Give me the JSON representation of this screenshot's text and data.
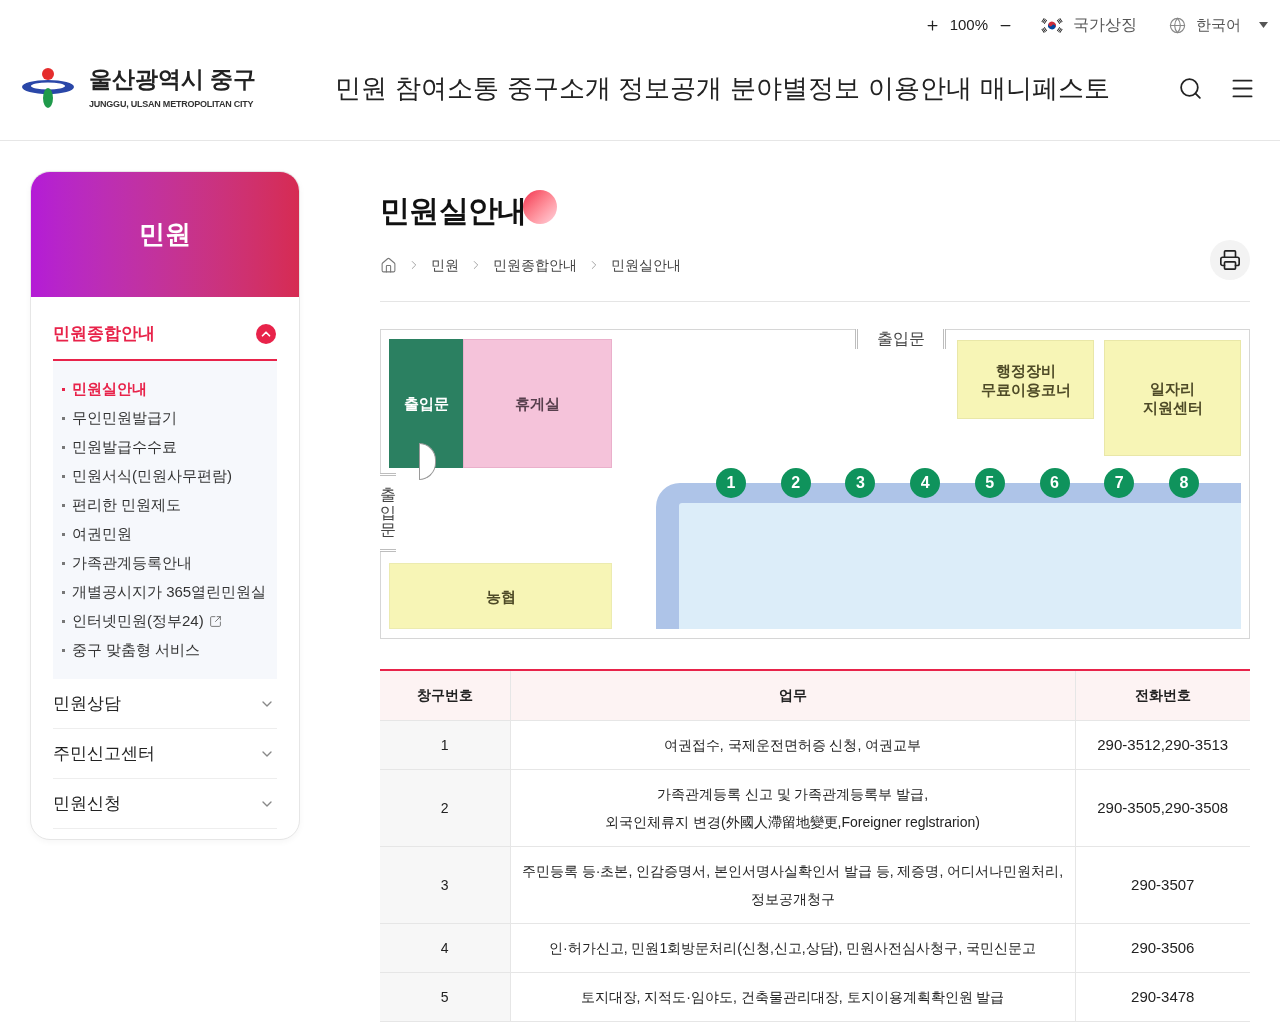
{
  "utility_bar": {
    "zoom_level": "100%",
    "national_symbols": "국가상징",
    "language": "한국어"
  },
  "header": {
    "logo": {
      "title": "울산광역시 중구",
      "subtitle": "JUNGGU, ULSAN METROPOLITAN CITY"
    },
    "nav": [
      "민원",
      "참여소통",
      "중구소개",
      "정보공개",
      "분야별정보",
      "이용안내",
      "매니페스토"
    ]
  },
  "sidebar": {
    "title": "민원",
    "sections": [
      {
        "label": "민원종합안내",
        "expanded": true,
        "children": [
          {
            "label": "민원실안내",
            "selected": true,
            "external": false
          },
          {
            "label": "무인민원발급기",
            "selected": false,
            "external": false
          },
          {
            "label": "민원발급수수료",
            "selected": false,
            "external": false
          },
          {
            "label": "민원서식(민원사무편람)",
            "selected": false,
            "external": false
          },
          {
            "label": "편리한 민원제도",
            "selected": false,
            "external": false
          },
          {
            "label": "여권민원",
            "selected": false,
            "external": false
          },
          {
            "label": "가족관계등록안내",
            "selected": false,
            "external": false
          },
          {
            "label": "개별공시지가 365열린민원실",
            "selected": false,
            "external": false
          },
          {
            "label": "인터넷민원(정부24)",
            "selected": false,
            "external": true
          },
          {
            "label": "중구 맞춤형 서비스",
            "selected": false,
            "external": false
          }
        ]
      },
      {
        "label": "민원상담",
        "expanded": false
      },
      {
        "label": "주민신고센터",
        "expanded": false
      },
      {
        "label": "민원신청",
        "expanded": false
      }
    ]
  },
  "page": {
    "title": "민원실안내",
    "breadcrumb": [
      "민원",
      "민원종합안내",
      "민원실안내"
    ]
  },
  "floor_plan": {
    "top_doorway": "출입문",
    "side_doorway": "출입문",
    "rooms": [
      {
        "kind": "entrance",
        "lines": [
          "출입문"
        ]
      },
      {
        "kind": "lounge",
        "lines": [
          "휴게실"
        ]
      },
      {
        "kind": "bank",
        "lines": [
          "농협"
        ]
      },
      {
        "kind": "equipment",
        "lines": [
          "행정장비",
          "무료이용코너"
        ]
      },
      {
        "kind": "jobs",
        "lines": [
          "일자리",
          "지원센터"
        ]
      }
    ],
    "windows": [
      "1",
      "2",
      "3",
      "4",
      "5",
      "6",
      "7",
      "8"
    ]
  },
  "table": {
    "columns": [
      "창구번호",
      "업무",
      "전화번호"
    ],
    "rows": [
      {
        "window": "1",
        "work": [
          "여권접수, 국제운전면허증 신청, 여권교부"
        ],
        "phone": "290-3512,290-3513"
      },
      {
        "window": "2",
        "work": [
          "가족관계등록 신고 및 가족관계등록부 발급,",
          "외국인체류지 변경(外國人滯留地變更,Foreigner reglstrarion)"
        ],
        "phone": "290-3505,290-3508"
      },
      {
        "window": "3",
        "work": [
          "주민등록 등·초본, 인감증명서, 본인서명사실확인서 발급 등, 제증명, 어디서나민원처리, 정보공개청구"
        ],
        "phone": "290-3507"
      },
      {
        "window": "4",
        "work": [
          "인·허가신고, 민원1회방문처리(신청,신고,상담), 민원사전심사청구, 국민신문고"
        ],
        "phone": "290-3506"
      },
      {
        "window": "5",
        "work": [
          "토지대장, 지적도·임야도, 건축물관리대장, 토지이용계획확인원 발급"
        ],
        "phone": "290-3478"
      }
    ]
  }
}
